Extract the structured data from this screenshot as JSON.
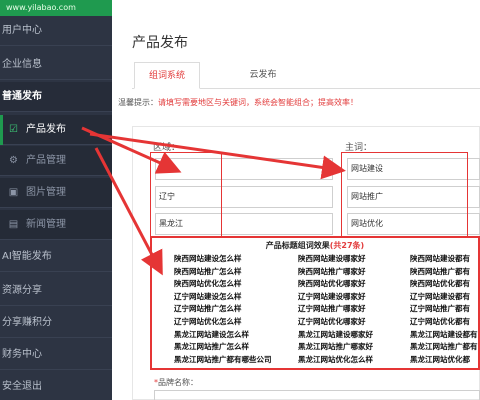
{
  "logo": {
    "url_text": "www.yilabao.com"
  },
  "sidebar": {
    "items": [
      {
        "label": "用户中心"
      },
      {
        "label": "企业信息"
      },
      {
        "label": "普通发布"
      },
      {
        "label": "产品发布",
        "icon": "edit-icon"
      },
      {
        "label": "产品管理",
        "icon": "gear-icon"
      },
      {
        "label": "图片管理",
        "icon": "image-icon"
      },
      {
        "label": "新闻管理",
        "icon": "news-icon"
      },
      {
        "label": "AI智能发布"
      },
      {
        "label": "资源分享"
      },
      {
        "label": "分享赚积分"
      },
      {
        "label": "财务中心"
      },
      {
        "label": "安全退出"
      }
    ]
  },
  "main": {
    "title": "产品发布",
    "tabs": [
      {
        "label": "组词系统",
        "active": true
      },
      {
        "label": "云发布",
        "active": false
      }
    ],
    "tip": {
      "prefix": "温馨提示：",
      "text": "请填写需要地区与关键词，系统会智能组合；提高效率！"
    }
  },
  "form": {
    "region_label": "区域：",
    "keyword_label": "主词：",
    "regions": [
      "陕西",
      "辽宁",
      "黑龙江"
    ],
    "keywords": [
      "网站建设",
      "网站推广",
      "网站优化"
    ],
    "brand_label": "品牌名称：",
    "brand_required": "*"
  },
  "result": {
    "title_prefix": "产品标题组词效果",
    "count_text": "(共27条)",
    "columns": [
      [
        "陕西网站建设怎么样",
        "陕西网站推广怎么样",
        "陕西网站优化怎么样",
        "辽宁网站建设怎么样",
        "辽宁网站推广怎么样",
        "辽宁网站优化怎么样",
        "黑龙江网站建设怎么样",
        "黑龙江网站推广怎么样",
        "黑龙江网站推广都有哪些公司"
      ],
      [
        "陕西网站建设哪家好",
        "陕西网站推广哪家好",
        "陕西网站优化哪家好",
        "辽宁网站建设哪家好",
        "辽宁网站推广哪家好",
        "辽宁网站优化哪家好",
        "黑龙江网站建设哪家好",
        "黑龙江网站推广哪家好",
        "黑龙江网站优化怎么样"
      ],
      [
        "陕西网站建设都有",
        "陕西网站推广都有",
        "陕西网站优化都有",
        "辽宁网站建设都有",
        "辽宁网站推广都有",
        "辽宁网站优化都有",
        "黑龙江网站建设都有",
        "黑龙江网站推广都有",
        "黑龙江网站优化都"
      ]
    ]
  },
  "colors": {
    "sidebar_bg": "#2d3443",
    "logo_green": "#1f9a4f",
    "accent_red": "#e23c3c",
    "annotation_red": "#e53535"
  }
}
